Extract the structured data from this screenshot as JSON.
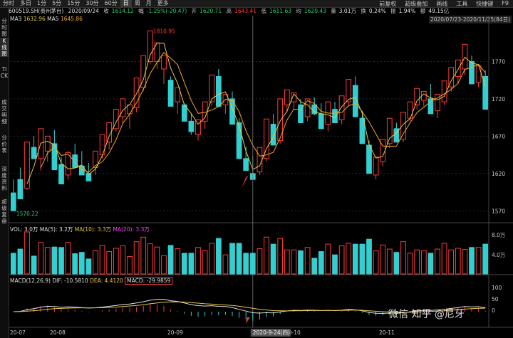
{
  "periods": [
    "分时",
    "多日",
    "1分",
    "5分",
    "15分",
    "30分",
    "60分",
    "日",
    "周",
    "月",
    "更多"
  ],
  "toolbar": [
    "前复权",
    "超级叠加",
    "画线",
    "工具",
    "快捷键",
    "F9"
  ],
  "sidebar": [
    "分时图",
    "K线图",
    "TICK",
    "成交明细",
    "分价表",
    "深度资料",
    "超级复盘"
  ],
  "info": {
    "code": "600519.SH(贵州茅台)",
    "date": "2020/09/24",
    "close_label": "收",
    "close": "1614.12",
    "chg_label": "幅",
    "chg": "-1.25%(-20.47)",
    "open_label": "开",
    "open": "1620.71",
    "high_label": "高",
    "high": "1643.41",
    "low_label": "低",
    "low": "1611.63",
    "avg_label": "均",
    "avg": "1620.43",
    "vol_label": "量",
    "vol": "3.01万",
    "turn_label": "换",
    "turn": "0.24%",
    "amp_label": "振",
    "amp": "1.94%",
    "amt_label": "额",
    "amt": "49.15亿"
  },
  "ma": {
    "ma3_label": "MA3",
    "ma3": "1632.96",
    "ma5_label": "MA5",
    "ma5": "1645.86"
  },
  "range_text": "2020/07/23-2020/11/25(84日)",
  "price_axis": [
    "1770",
    "1720",
    "1670",
    "1620",
    "1570"
  ],
  "high_mark": "1810.95",
  "low_mark": "1570.22",
  "vol_label": {
    "vol": "VOL: 3.0万",
    "ma5": "MA(5): 3.2万",
    "ma10": "MA(10): 3.3万",
    "ma20": "MA(20): 3.3万"
  },
  "vol_axis": [
    "8.0万",
    "4.0万"
  ],
  "macd_label": {
    "name": "MACD(12,26,9)",
    "dif": "DIF: -10.5810",
    "dea": "DEA: 4.4120",
    "macd": "MACD: -29.9859"
  },
  "macd_axis": [
    "100",
    "50",
    "0"
  ],
  "x_axis": [
    "20-07",
    "20-08",
    "20-09",
    "20-10",
    "20-11"
  ],
  "cursor_date": "2020-9-24(四)",
  "watermark": "微信  知乎 @尼牙",
  "colors": {
    "up": "#ff3b3b",
    "down": "#33cfd0",
    "ma3": "#e6c84a",
    "ma5": "#f5a623",
    "mid": "#e0e0e0"
  },
  "chart_data": {
    "type": "candlestick",
    "ohlc": [
      [
        1594,
        1612,
        1576,
        1570
      ],
      [
        1612,
        1628,
        1588,
        1586
      ],
      [
        1600,
        1660,
        1598,
        1662
      ],
      [
        1655,
        1670,
        1640,
        1640
      ],
      [
        1640,
        1676,
        1624,
        1680
      ],
      [
        1650,
        1668,
        1636,
        1670
      ],
      [
        1660,
        1678,
        1630,
        1625
      ],
      [
        1632,
        1642,
        1610,
        1606
      ],
      [
        1618,
        1650,
        1612,
        1648
      ],
      [
        1645,
        1660,
        1630,
        1628
      ],
      [
        1630,
        1650,
        1622,
        1618
      ],
      [
        1620,
        1634,
        1614,
        1610
      ],
      [
        1628,
        1640,
        1618,
        1650
      ],
      [
        1645,
        1668,
        1640,
        1672
      ],
      [
        1662,
        1684,
        1652,
        1688
      ],
      [
        1680,
        1704,
        1676,
        1706
      ],
      [
        1696,
        1716,
        1688,
        1720
      ],
      [
        1700,
        1712,
        1680,
        1712
      ],
      [
        1708,
        1740,
        1702,
        1748
      ],
      [
        1735,
        1770,
        1730,
        1778
      ],
      [
        1770,
        1811,
        1766,
        1811
      ],
      [
        1770,
        1790,
        1760,
        1795
      ],
      [
        1760,
        1772,
        1740,
        1778
      ],
      [
        1745,
        1750,
        1716,
        1710
      ],
      [
        1716,
        1730,
        1700,
        1735
      ],
      [
        1712,
        1714,
        1692,
        1690
      ],
      [
        1690,
        1700,
        1672,
        1676
      ],
      [
        1672,
        1688,
        1664,
        1692
      ],
      [
        1690,
        1712,
        1680,
        1716
      ],
      [
        1716,
        1750,
        1710,
        1752
      ],
      [
        1750,
        1760,
        1712,
        1710
      ],
      [
        1712,
        1724,
        1700,
        1726
      ],
      [
        1720,
        1730,
        1690,
        1686
      ],
      [
        1688,
        1694,
        1644,
        1640
      ],
      [
        1640,
        1656,
        1626,
        1624
      ],
      [
        1620,
        1643,
        1614,
        1612
      ],
      [
        1622,
        1650,
        1618,
        1655
      ],
      [
        1640,
        1690,
        1636,
        1693
      ],
      [
        1686,
        1700,
        1660,
        1658
      ],
      [
        1664,
        1710,
        1660,
        1720
      ],
      [
        1712,
        1730,
        1702,
        1732
      ],
      [
        1716,
        1726,
        1706,
        1728
      ],
      [
        1712,
        1720,
        1692,
        1688
      ],
      [
        1696,
        1716,
        1690,
        1720
      ],
      [
        1712,
        1722,
        1698,
        1700
      ],
      [
        1700,
        1714,
        1684,
        1680
      ],
      [
        1686,
        1712,
        1676,
        1716
      ],
      [
        1706,
        1716,
        1690,
        1688
      ],
      [
        1692,
        1720,
        1686,
        1724
      ],
      [
        1716,
        1740,
        1710,
        1746
      ],
      [
        1738,
        1750,
        1700,
        1696
      ],
      [
        1694,
        1704,
        1666,
        1660
      ],
      [
        1658,
        1664,
        1624,
        1620
      ],
      [
        1618,
        1640,
        1612,
        1642
      ],
      [
        1636,
        1664,
        1630,
        1666
      ],
      [
        1660,
        1690,
        1654,
        1694
      ],
      [
        1680,
        1688,
        1664,
        1662
      ],
      [
        1666,
        1700,
        1662,
        1702
      ],
      [
        1694,
        1714,
        1690,
        1716
      ],
      [
        1712,
        1730,
        1706,
        1734
      ],
      [
        1718,
        1730,
        1710,
        1730
      ],
      [
        1720,
        1740,
        1700,
        1700
      ],
      [
        1704,
        1724,
        1694,
        1726
      ],
      [
        1716,
        1740,
        1712,
        1744
      ],
      [
        1736,
        1760,
        1730,
        1762
      ],
      [
        1750,
        1770,
        1740,
        1772
      ],
      [
        1760,
        1790,
        1752,
        1793
      ],
      [
        1770,
        1778,
        1740,
        1740
      ],
      [
        1742,
        1760,
        1736,
        1764
      ],
      [
        1750,
        1758,
        1710,
        1706
      ]
    ]
  }
}
